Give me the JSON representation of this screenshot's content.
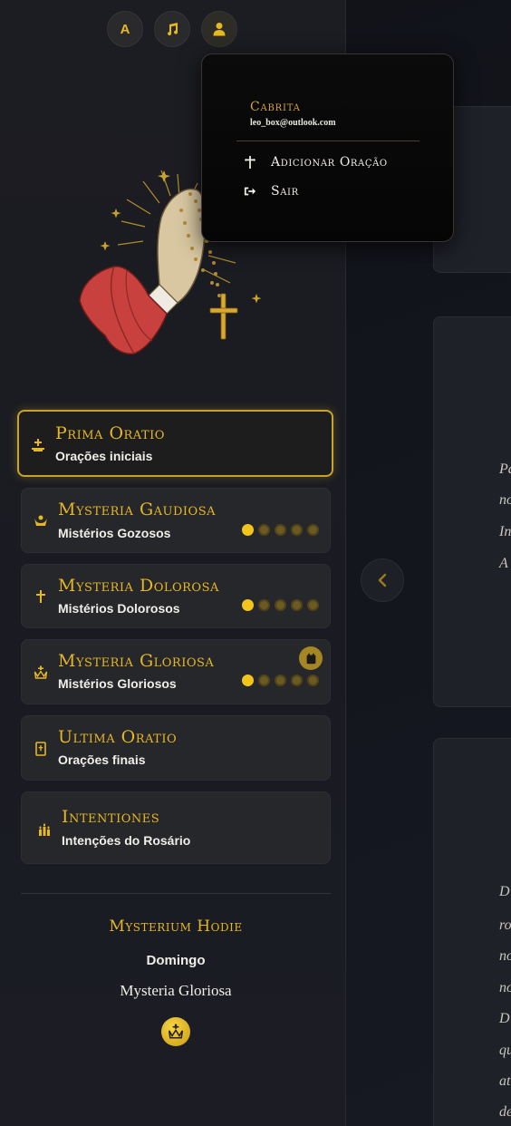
{
  "toolbar": {
    "font_button_label": "A",
    "music_icon": "music-note-icon",
    "user_icon": "user-icon"
  },
  "user_menu": {
    "name": "Cabrita",
    "email": "leo_box@outlook.com",
    "items": [
      {
        "label": "Adicionar Oração",
        "icon": "cross-plus-icon"
      },
      {
        "label": "Sair",
        "icon": "sign-out-icon"
      }
    ]
  },
  "nav": {
    "items": [
      {
        "title": "Prima Oratio",
        "subtitle": "Orações iniciais",
        "icon": "altar-cross-icon",
        "active": true
      },
      {
        "title": "Mysteria Gaudiosa",
        "subtitle": "Mistérios Gozosos",
        "icon": "angel-icon",
        "progress": "1 of 5"
      },
      {
        "title": "Mysteria Dolorosa",
        "subtitle": "Mistérios Dolorosos",
        "icon": "cross-icon",
        "progress": "1 of 5"
      },
      {
        "title": "Mysteria Gloriosa",
        "subtitle": "Mistérios Gloriosos",
        "icon": "crown-icon",
        "progress": "1 of 5",
        "badge": "calendar-icon"
      },
      {
        "title": "Ultima Oratio",
        "subtitle": "Orações finais",
        "icon": "book-icon"
      },
      {
        "title": "Intentiones",
        "subtitle": "Intenções do Rosário",
        "icon": "candles-icon"
      }
    ]
  },
  "today": {
    "title": "Mysterium Hodie",
    "day": "Domingo",
    "mystery": "Mysteria Gloriosa",
    "icon": "crown-icon"
  },
  "main": {
    "panel2_lines": [
      "Pa",
      "no",
      "In",
      "A"
    ],
    "panel3_lines": [
      "D",
      "ro",
      "no",
      "no",
      "D",
      "qu",
      "at",
      "de"
    ]
  },
  "colors": {
    "accent": "#e6b623",
    "background": "#15171d",
    "card": "#26272b",
    "active_border": "#c9a22c"
  }
}
